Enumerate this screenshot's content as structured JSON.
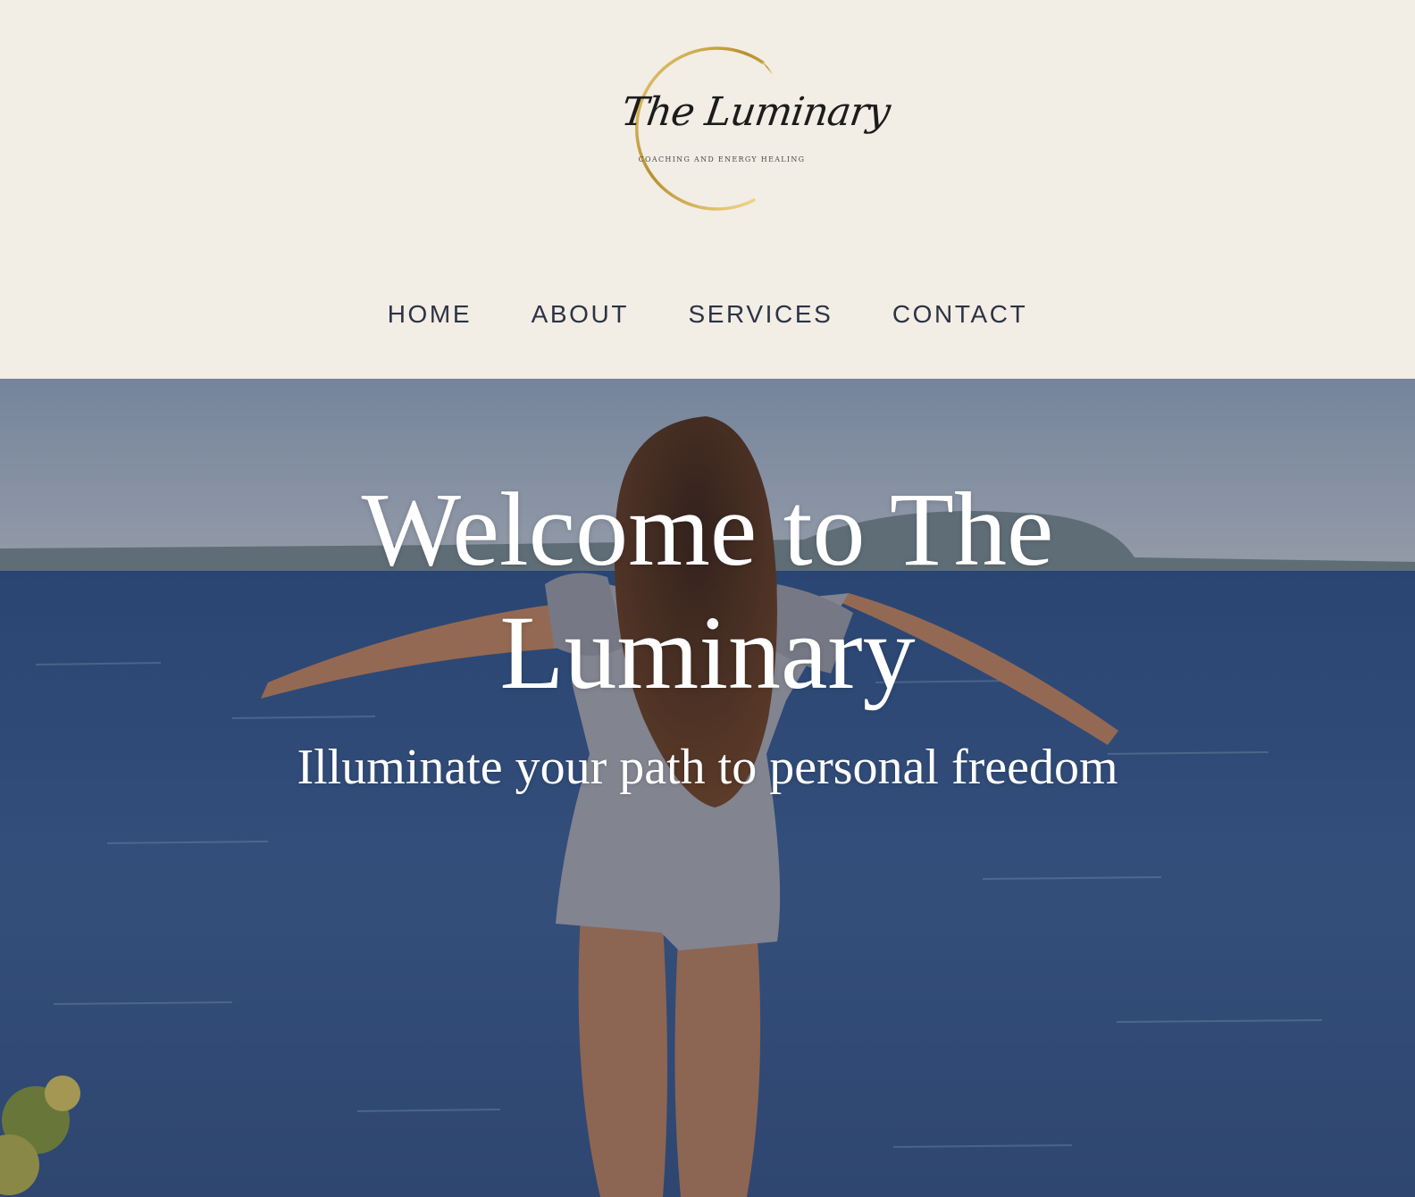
{
  "header": {
    "logo": {
      "script_text": "The Luminary",
      "tagline": "COACHING AND ENERGY HEALING"
    },
    "nav": [
      {
        "label": "HOME"
      },
      {
        "label": "ABOUT"
      },
      {
        "label": "SERVICES"
      },
      {
        "label": "CONTACT"
      }
    ]
  },
  "hero": {
    "title": "Welcome to The Luminary",
    "subtitle": "Illuminate your path to personal freedom"
  },
  "colors": {
    "header_bg": "#f2ede5",
    "nav_text": "#2d3344",
    "logo_ring": "#c9a548",
    "hero_text": "#ffffff",
    "sea": "#3a5683"
  }
}
